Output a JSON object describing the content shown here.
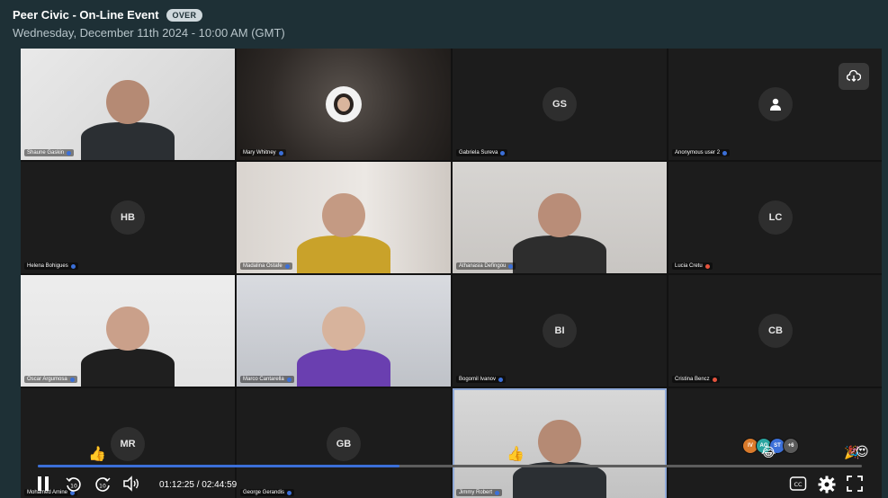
{
  "header": {
    "title": "Peer Civic - On-Line Event",
    "badge": "OVER",
    "subtitle": "Wednesday, December 11th 2024 - 10:00 AM (GMT)"
  },
  "participants": [
    {
      "name": "Shaune Gaskin",
      "initials": "",
      "video": true,
      "dot": "#3b6fd8"
    },
    {
      "name": "Mary Whitney",
      "initials": "",
      "video": true,
      "dot": "#3b6fd8"
    },
    {
      "name": "Gabriela Sureva",
      "initials": "GS",
      "video": false,
      "dot": "#3b6fd8"
    },
    {
      "name": "Anonymous user 2",
      "initials": "",
      "video": false,
      "dot": "#3b6fd8"
    },
    {
      "name": "Helena Bohigues",
      "initials": "HB",
      "video": false,
      "dot": "#3b6fd8"
    },
    {
      "name": "Madalina Ostafe",
      "initials": "",
      "video": true,
      "dot": "#3b6fd8"
    },
    {
      "name": "Athanasia Defingou",
      "initials": "",
      "video": true,
      "dot": "#3b6fd8"
    },
    {
      "name": "Lucia Cretu",
      "initials": "LC",
      "video": false,
      "dot": "#e5533d"
    },
    {
      "name": "Oscar Argumosa",
      "initials": "",
      "video": true,
      "dot": "#3b6fd8"
    },
    {
      "name": "Marco Cantarella",
      "initials": "",
      "video": true,
      "dot": "#3b6fd8"
    },
    {
      "name": "Bogomil Ivanov",
      "initials": "BI",
      "video": false,
      "dot": "#3b6fd8"
    },
    {
      "name": "Cristina Bencz",
      "initials": "CB",
      "video": false,
      "dot": "#e5533d"
    },
    {
      "name": "Mohamed Amine",
      "initials": "MR",
      "video": false,
      "dot": "#3b6fd8"
    },
    {
      "name": "George Gerandis",
      "initials": "GB",
      "video": false,
      "dot": "#3b6fd8"
    },
    {
      "name": "Jimmy Robert",
      "initials": "",
      "video": true,
      "dot": "#3b6fd8"
    },
    {
      "name": "",
      "initials": "",
      "video": false,
      "dot": ""
    }
  ],
  "reactions": {
    "thumbs": "👍",
    "laugh": "😂",
    "party": "🎉",
    "heart_eyes": "😍",
    "avatars": [
      {
        "label": "IV",
        "color": "#d97a2b"
      },
      {
        "label": "AG",
        "color": "#2aa5a0"
      },
      {
        "label": "ST",
        "color": "#3b6fd8"
      },
      {
        "label": "+6",
        "color": "#5a5a5a"
      }
    ]
  },
  "player": {
    "time_display": "01:12:25 / 02:44:59",
    "progress": 0.4385,
    "accent": "#3b6fd8",
    "icons": [
      "pause-icon",
      "rewind-10-icon",
      "forward-10-icon",
      "volume-icon",
      "cc-icon",
      "gear-icon",
      "fullscreen-icon",
      "cloud-download-icon"
    ]
  }
}
